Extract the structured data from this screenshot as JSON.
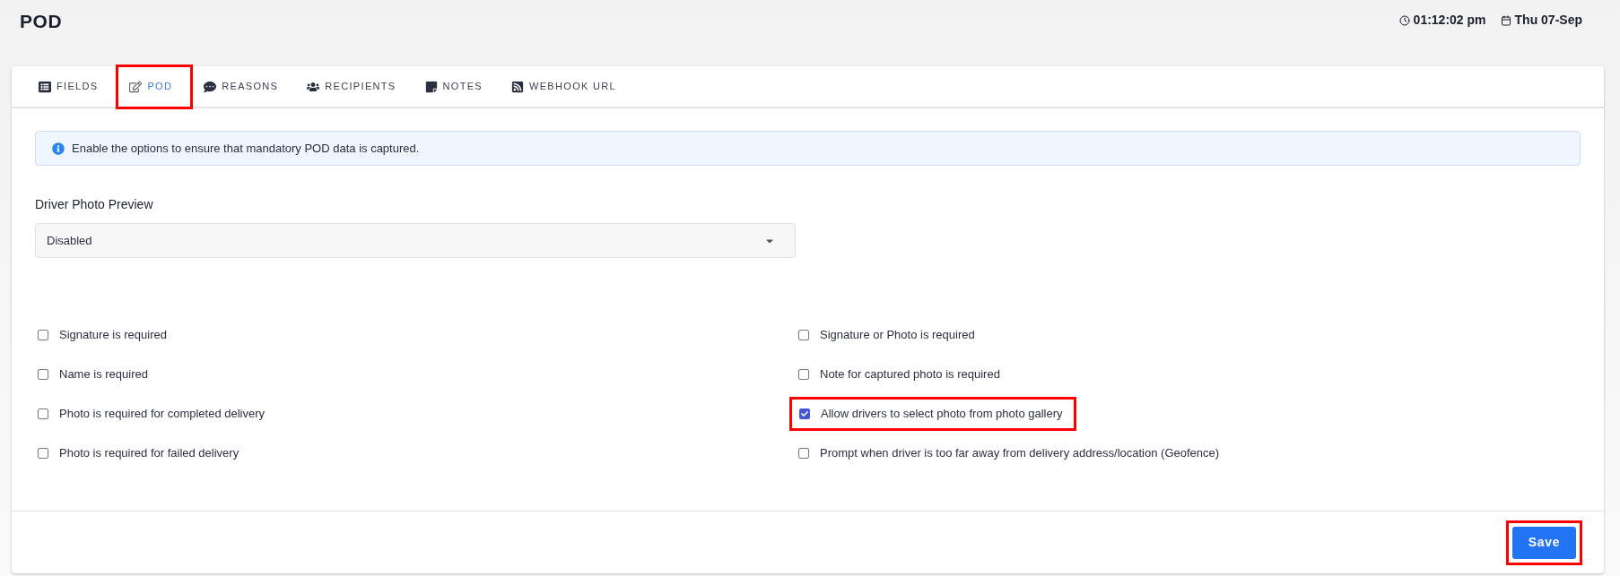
{
  "header": {
    "title": "POD",
    "time": "01:12:02 pm",
    "date": "Thu 07-Sep"
  },
  "tabs": [
    {
      "label": "FIELDS",
      "selected": false,
      "highlighted": false
    },
    {
      "label": "POD",
      "selected": true,
      "highlighted": true
    },
    {
      "label": "REASONS",
      "selected": false,
      "highlighted": false
    },
    {
      "label": "RECIPIENTS",
      "selected": false,
      "highlighted": false
    },
    {
      "label": "NOTES",
      "selected": false,
      "highlighted": false
    },
    {
      "label": "WEBHOOK URL",
      "selected": false,
      "highlighted": false
    }
  ],
  "info": "Enable the options to ensure that mandatory POD data is captured.",
  "driver_photo_preview": {
    "label": "Driver Photo Preview",
    "value": "Disabled"
  },
  "option_columns": [
    [
      {
        "label": "Signature is required",
        "checked": false,
        "highlighted": false
      },
      {
        "label": "Name is required",
        "checked": false,
        "highlighted": false
      },
      {
        "label": "Photo is required for completed delivery",
        "checked": false,
        "highlighted": false
      },
      {
        "label": "Photo is required for failed delivery",
        "checked": false,
        "highlighted": false
      }
    ],
    [
      {
        "label": "Signature or Photo is required",
        "checked": false,
        "highlighted": false
      },
      {
        "label": "Note for captured photo is required",
        "checked": false,
        "highlighted": false
      },
      {
        "label": "Allow drivers to select photo from photo gallery",
        "checked": true,
        "highlighted": true
      },
      {
        "label": "Prompt when driver is too far away from delivery address/location (Geofence)",
        "checked": false,
        "highlighted": false
      }
    ]
  ],
  "save": {
    "label": "Save",
    "highlighted": true
  }
}
